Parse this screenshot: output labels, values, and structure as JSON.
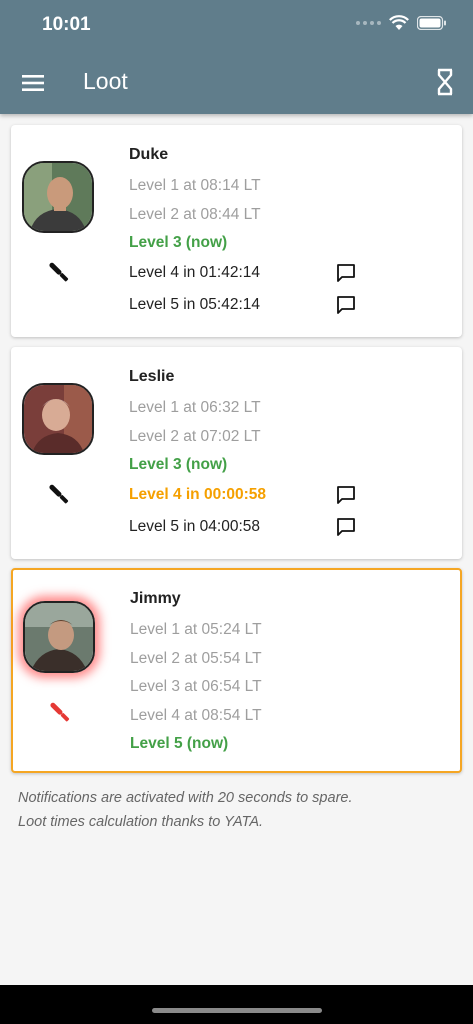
{
  "status": {
    "time": "10:01"
  },
  "appbar": {
    "title": "Loot"
  },
  "npcs": [
    {
      "name": "Duke",
      "levels": [
        "Level 1 at 08:14 LT",
        "Level 2 at 08:44 LT",
        "Level 3 (now)",
        "Level 4 in 01:42:14",
        "Level 5 in 05:42:14"
      ]
    },
    {
      "name": "Leslie",
      "levels": [
        "Level 1 at 06:32 LT",
        "Level 2 at 07:02 LT",
        "Level 3 (now)",
        "Level 4 in 00:00:58",
        "Level 5 in 04:00:58"
      ]
    },
    {
      "name": "Jimmy",
      "levels": [
        "Level 1 at 05:24 LT",
        "Level 2 at 05:54 LT",
        "Level 3 at 06:54 LT",
        "Level 4 at 08:54 LT",
        "Level 5 (now)"
      ]
    }
  ],
  "footer": {
    "line1": "Notifications are activated with 20 seconds to spare.",
    "line2": "Loot times calculation thanks to YATA."
  },
  "colors": {
    "appbar": "#607d8b",
    "now": "#43a047",
    "next": "#f5a000",
    "past": "#9e9e9e",
    "highlight_border": "#f5a623",
    "attack_icon_active": "#e53935"
  }
}
